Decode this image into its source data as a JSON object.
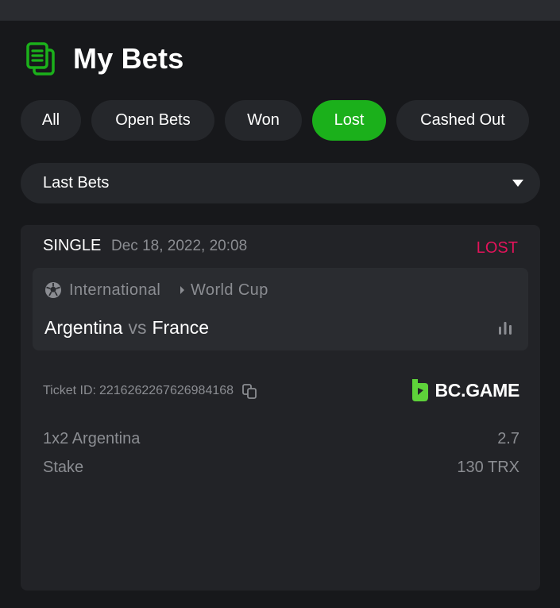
{
  "header": {
    "title": "My Bets",
    "icon": "bets-list-icon"
  },
  "filters": [
    {
      "label": "All",
      "active": false
    },
    {
      "label": "Open Bets",
      "active": false
    },
    {
      "label": "Won",
      "active": false
    },
    {
      "label": "Lost",
      "active": true
    },
    {
      "label": "Cashed Out",
      "active": false
    }
  ],
  "dropdown": {
    "selected": "Last Bets"
  },
  "bet": {
    "type": "SINGLE",
    "date": "Dec 18, 2022, 20:08",
    "status": "LOST",
    "league": "International",
    "competition": "World Cup",
    "home_team": "Argentina",
    "vs": "vs",
    "away_team": "France",
    "ticket_label": "Ticket ID:",
    "ticket_id": "2216262267626984168",
    "brand": "BC.GAME",
    "market": "1x2 Argentina",
    "odds": "2.7",
    "stake_label": "Stake",
    "stake": "130 TRX"
  },
  "colors": {
    "accent": "#1bb01b",
    "lost": "#e2135a",
    "background": "#17181b",
    "card": "#222327"
  }
}
